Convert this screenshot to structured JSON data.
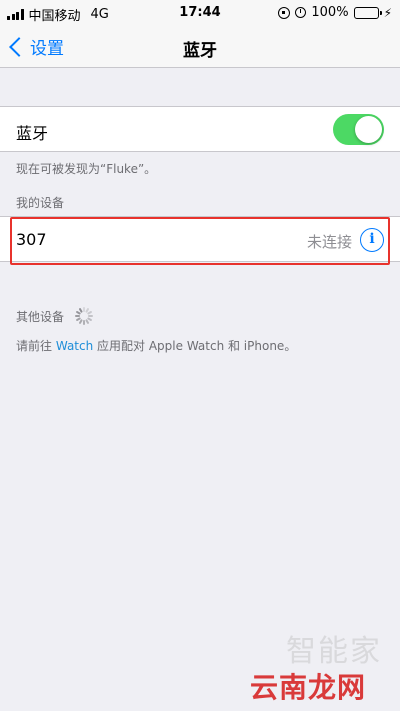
{
  "status_bar": {
    "carrier": "中国移动",
    "network": "4G",
    "time": "17:44",
    "battery": "100%"
  },
  "nav": {
    "back_label": "设置",
    "title": "蓝牙"
  },
  "bluetooth": {
    "label": "蓝牙",
    "enabled": true,
    "discoverable_text": "现在可被发现为“Fluke”。"
  },
  "my_devices": {
    "header": "我的设备",
    "items": [
      {
        "name": "307",
        "status": "未连接"
      }
    ]
  },
  "other_devices": {
    "header": "其他设备",
    "hint_prefix": "请前往",
    "hint_link": "Watch",
    "hint_suffix": "应用配对 Apple Watch 和 iPhone。"
  },
  "watermark": {
    "top_text": "智能家",
    "bottom_text": "云南龙网"
  },
  "colors": {
    "accent": "#007aff",
    "toggle_on": "#4cd964",
    "highlight": "#e8322c",
    "background": "#efeff4"
  }
}
